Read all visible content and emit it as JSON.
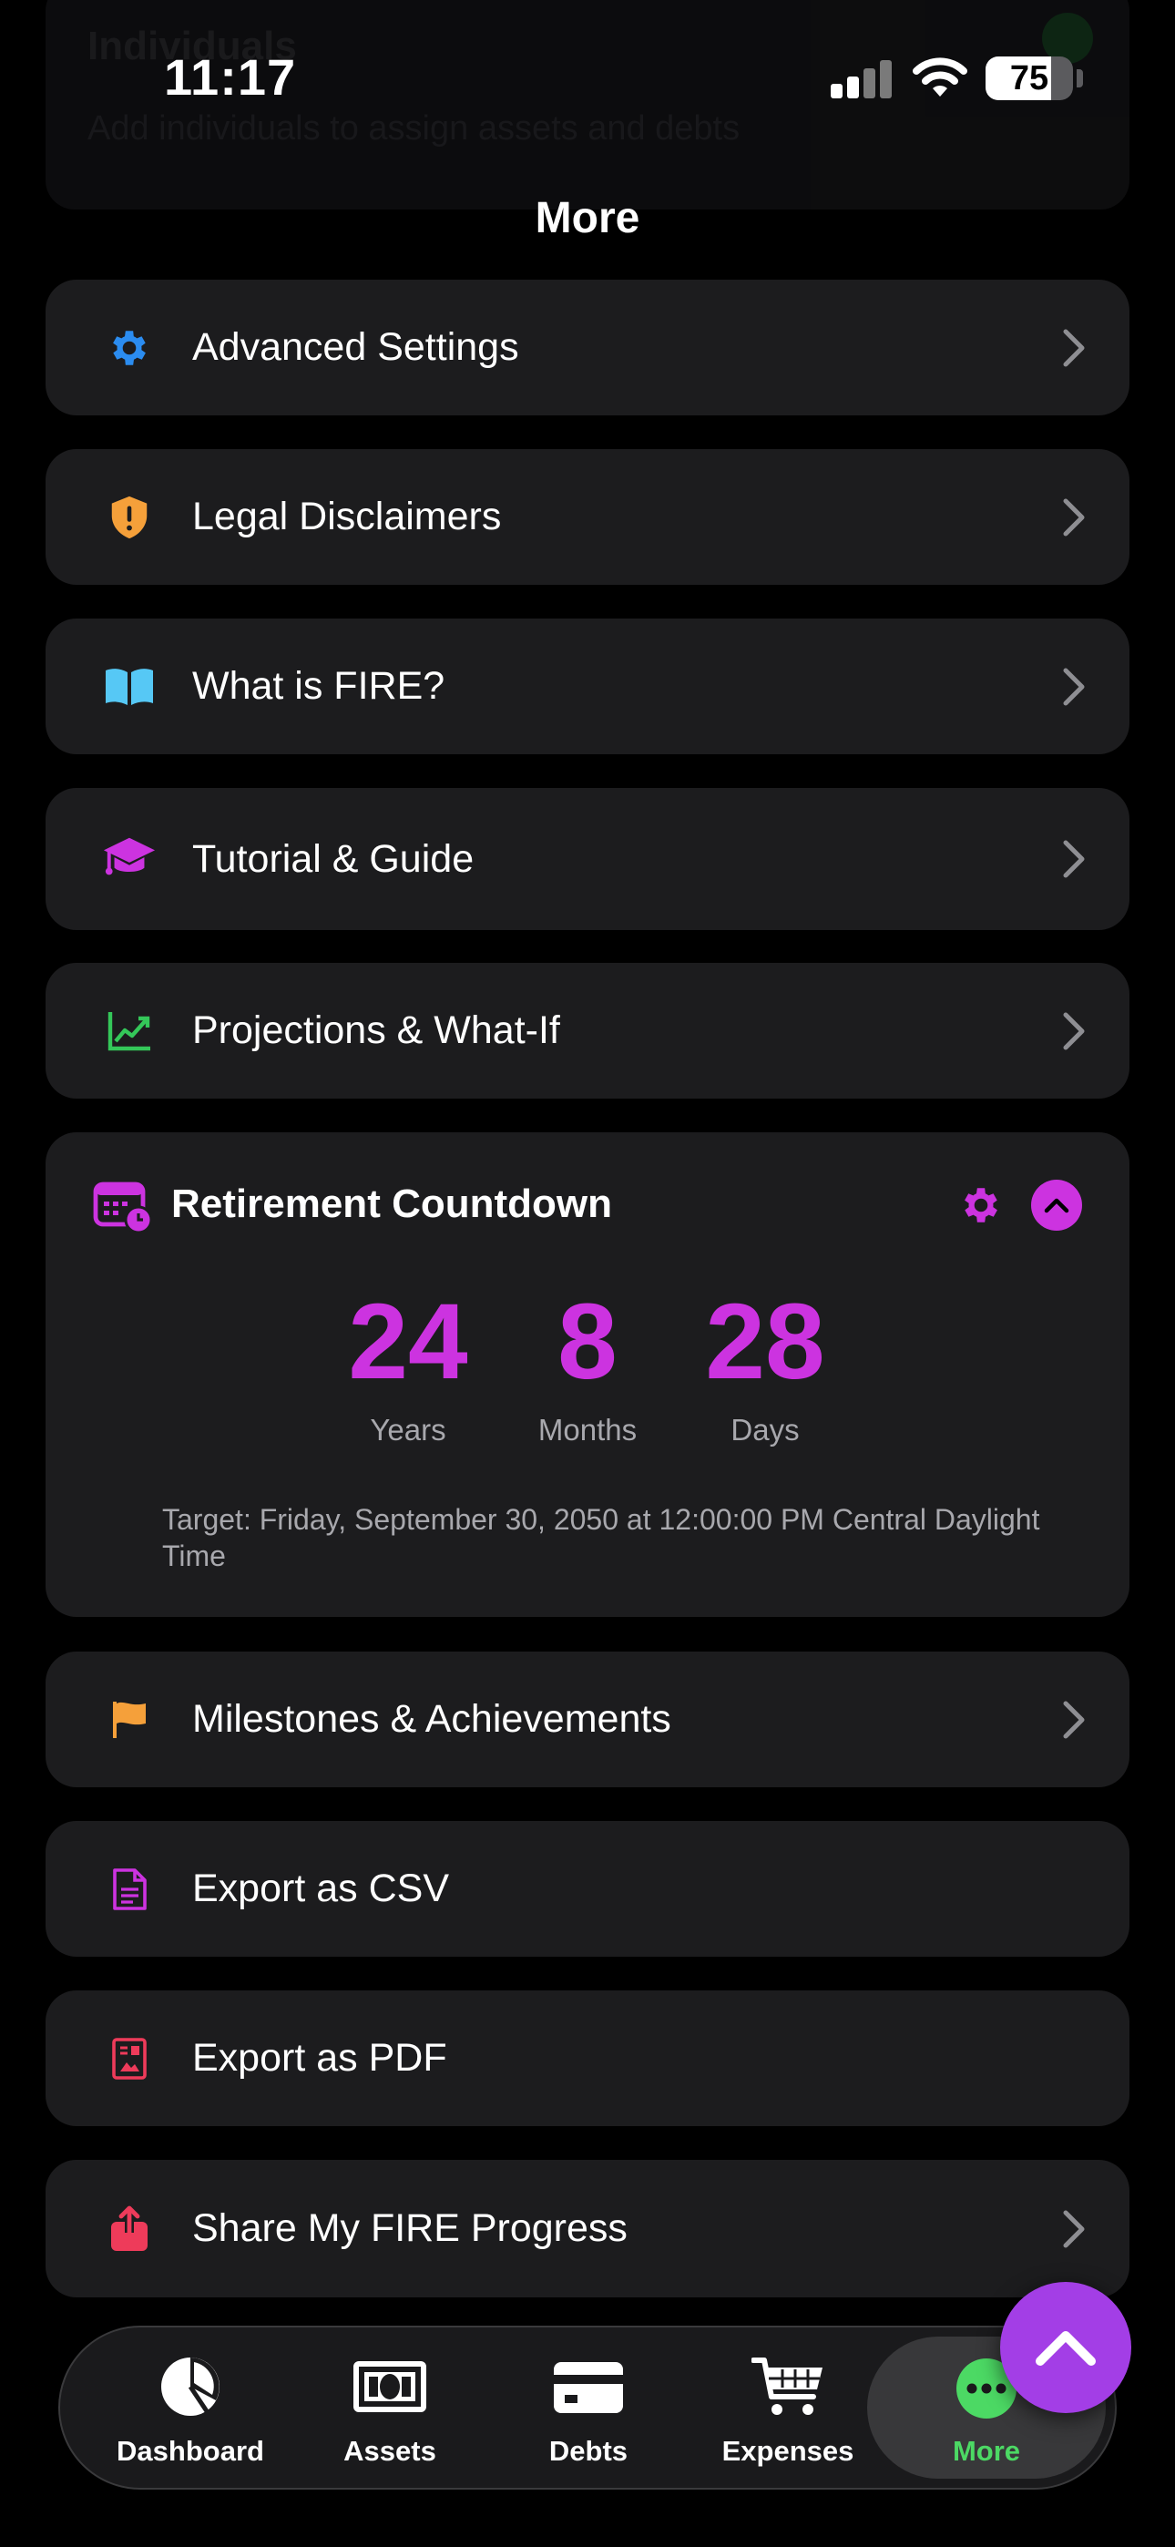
{
  "background_card": {
    "title": "Individuals",
    "subtitle": "Add individuals to assign assets and debts"
  },
  "status_bar": {
    "time": "11:17",
    "battery": "75",
    "battery_fraction": 0.75
  },
  "nav": {
    "title": "More"
  },
  "menu_top": [
    {
      "label": "Advanced Settings",
      "icon": "gear-icon",
      "color": "#2b8cf0"
    },
    {
      "label": "Legal Disclaimers",
      "icon": "shield-exclamation-icon",
      "color": "#f5a03a"
    },
    {
      "label": "What is FIRE?",
      "icon": "book-icon",
      "color": "#56c8f5"
    },
    {
      "label": "Tutorial & Guide",
      "icon": "graduation-cap-icon",
      "color": "#cc33e0"
    },
    {
      "label": "Projections & What-If",
      "icon": "chart-line-icon",
      "color": "#34c759"
    }
  ],
  "countdown": {
    "title": "Retirement Countdown",
    "accent": "#cc33e0",
    "years": "24",
    "years_label": "Years",
    "months": "8",
    "months_label": "Months",
    "days": "28",
    "days_label": "Days",
    "target": "Target: Friday, September 30, 2050 at 12:00:00 PM Central Daylight Time"
  },
  "menu_bottom": [
    {
      "label": "Milestones & Achievements",
      "icon": "flag-icon",
      "color": "#f5a03a"
    },
    {
      "label": "Export as CSV",
      "icon": "document-icon",
      "color": "#cc33e0"
    },
    {
      "label": "Export as PDF",
      "icon": "pdf-document-icon",
      "color": "#ee3b5a"
    },
    {
      "label": "Share My FIRE Progress",
      "icon": "share-icon",
      "color": "#ee3b5a"
    }
  ],
  "tabs": [
    {
      "label": "Dashboard",
      "icon": "pie-chart-icon"
    },
    {
      "label": "Assets",
      "icon": "banknote-icon"
    },
    {
      "label": "Debts",
      "icon": "credit-card-icon"
    },
    {
      "label": "Expenses",
      "icon": "cart-icon"
    },
    {
      "label": "More",
      "icon": "more-dots-icon",
      "active": true,
      "active_color": "#4cd964"
    }
  ]
}
